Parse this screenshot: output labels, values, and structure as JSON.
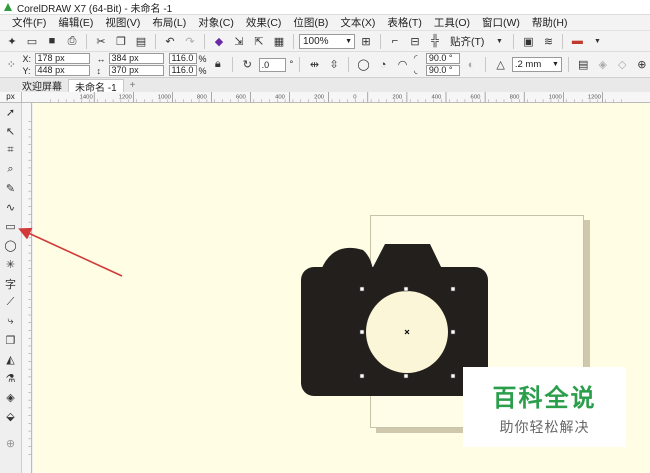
{
  "window": {
    "title": "CorelDRAW X7 (64-Bit) - 未命名 -1"
  },
  "menu": [
    "文件(F)",
    "编辑(E)",
    "视图(V)",
    "布局(L)",
    "对象(C)",
    "效果(C)",
    "位图(B)",
    "文本(X)",
    "表格(T)",
    "工具(O)",
    "窗口(W)",
    "帮助(H)"
  ],
  "toolbar": {
    "zoom": "100%",
    "snap_label": "贴齐(T)"
  },
  "props": {
    "x": "178 px",
    "y": "448 px",
    "width": "384 px",
    "height": "370 px",
    "scale_w": "116.0",
    "scale_h": "116.0",
    "pct": "%",
    "rotation": ".0",
    "degree": "°",
    "angle1": "90.0 °",
    "angle2": "90.0 °",
    "outline": ".2 mm"
  },
  "tabs": {
    "welcome": "欢迎屏幕",
    "doc": "未命名 -1",
    "add": "+"
  },
  "ruler": {
    "corner": "px",
    "h_labels": [
      "1400",
      "1200",
      "1000",
      "800",
      "600",
      "400",
      "200",
      "0",
      "200",
      "400",
      "600",
      "800",
      "1000",
      "1200"
    ]
  },
  "watermark": {
    "title": "百科全说",
    "subtitle": "助你轻松解决"
  },
  "colors": {
    "canvas": "#fffde3",
    "camera": "#231f1c",
    "lens": "#fbf6d7",
    "arrow": "#d23a3a",
    "watermark_green": "#2a9e4a"
  }
}
